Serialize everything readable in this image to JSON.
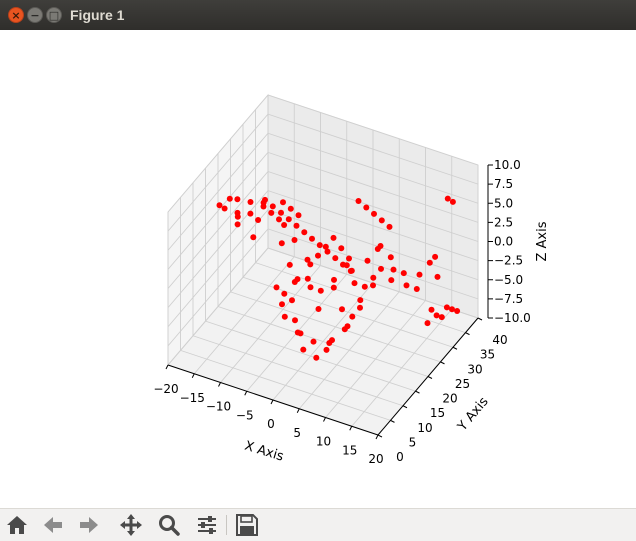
{
  "window": {
    "title": "Figure 1",
    "close_glyph": "×",
    "minimize_glyph": "−",
    "maximize_glyph": "□"
  },
  "toolbar": {
    "buttons": [
      {
        "name": "home-button",
        "icon": "home-icon"
      },
      {
        "name": "back-button",
        "icon": "arrow-left-icon"
      },
      {
        "name": "forward-button",
        "icon": "arrow-right-icon"
      },
      {
        "name": "pan-button",
        "icon": "move-icon"
      },
      {
        "name": "zoom-button",
        "icon": "magnifier-icon"
      },
      {
        "name": "configure-subplots-button",
        "icon": "sliders-icon"
      },
      {
        "name": "save-button",
        "icon": "floppy-disk-icon"
      }
    ]
  },
  "chart_data": {
    "type": "scatter",
    "projection": "3d",
    "title": "",
    "xlabel": "X Axis",
    "ylabel": "Y Axis",
    "zlabel": "Z Axis",
    "xlim": [
      -20,
      20
    ],
    "ylim": [
      0,
      40
    ],
    "zlim": [
      -10,
      10
    ],
    "xticks": [
      "−20",
      "−15",
      "−10",
      "−5",
      "0",
      "5",
      "10",
      "15",
      "20"
    ],
    "yticks": [
      "0",
      "5",
      "10",
      "15",
      "20",
      "25",
      "30",
      "35",
      "40"
    ],
    "zticks": [
      "−10.0",
      "−7.5",
      "−5.0",
      "−2.5",
      "0.0",
      "2.5",
      "5.0",
      "7.5",
      "10.0"
    ],
    "grid": true,
    "marker_color": "#ff0000",
    "series": [
      {
        "points": [
          [
            -14,
            8,
            9.2
          ],
          [
            -13.5,
            9,
            8.5
          ],
          [
            -13,
            10,
            9.5
          ],
          [
            -12,
            11,
            7.5
          ],
          [
            -12.5,
            12,
            8.8
          ],
          [
            -11,
            9,
            8
          ],
          [
            -11.5,
            10,
            6.5
          ],
          [
            -10,
            12,
            9
          ],
          [
            -10.5,
            13,
            7
          ],
          [
            -9,
            11,
            5
          ],
          [
            -9.5,
            14,
            6
          ],
          [
            -8,
            13,
            8.5
          ],
          [
            -7.5,
            12,
            9.5
          ],
          [
            -7,
            14,
            7.5
          ],
          [
            -6,
            15,
            6.5
          ],
          [
            -5.5,
            16,
            5.5
          ],
          [
            -5,
            14,
            4
          ],
          [
            -4,
            17,
            3.5
          ],
          [
            -3,
            13,
            2
          ],
          [
            -2,
            18,
            1
          ],
          [
            -1,
            16,
            -0.5
          ],
          [
            0,
            15,
            -1
          ],
          [
            1,
            17,
            -2
          ],
          [
            2,
            14,
            -3
          ],
          [
            3,
            18,
            -1.5
          ],
          [
            4,
            16,
            0.5
          ],
          [
            5,
            19,
            1.5
          ],
          [
            6,
            15,
            -2.5
          ],
          [
            7,
            17,
            -4
          ],
          [
            8,
            18,
            -3
          ],
          [
            9,
            16,
            -1
          ],
          [
            10,
            19,
            0
          ],
          [
            11,
            17,
            2
          ],
          [
            12,
            18,
            3
          ],
          [
            13,
            20,
            1
          ],
          [
            -4,
            12,
            -3
          ],
          [
            -3,
            11,
            -4
          ],
          [
            -2,
            13,
            -5
          ],
          [
            -1,
            12,
            -6
          ],
          [
            0,
            11,
            -5.5
          ],
          [
            1,
            10,
            -7
          ],
          [
            2,
            12,
            -6.5
          ],
          [
            3,
            11,
            -8
          ],
          [
            4,
            13,
            -7.5
          ],
          [
            5,
            12,
            -6
          ],
          [
            6,
            11,
            -5
          ],
          [
            7,
            14,
            -4.5
          ],
          [
            8,
            13,
            -3.5
          ],
          [
            -6,
            14,
            -2
          ],
          [
            -5,
            15,
            -3
          ],
          [
            -4,
            16,
            -4
          ],
          [
            -3,
            15,
            -1
          ],
          [
            -2,
            14,
            0
          ],
          [
            -1,
            17,
            1
          ],
          [
            0,
            18,
            2
          ],
          [
            1,
            19,
            3
          ],
          [
            2,
            20,
            4
          ],
          [
            3,
            21,
            2.5
          ],
          [
            4,
            22,
            1
          ],
          [
            5,
            21,
            0
          ],
          [
            6,
            20,
            -1
          ],
          [
            7,
            22,
            -2
          ],
          [
            8,
            21,
            2
          ],
          [
            9,
            23,
            3
          ],
          [
            10,
            22,
            4
          ],
          [
            11,
            24,
            2
          ],
          [
            12,
            23,
            1
          ],
          [
            13,
            25,
            0
          ],
          [
            14,
            24,
            -1
          ],
          [
            15,
            26,
            -2
          ],
          [
            16,
            25,
            0.5
          ],
          [
            17,
            27,
            1.5
          ],
          [
            18,
            28,
            -0.5
          ],
          [
            19,
            30,
            9.2
          ],
          [
            19.5,
            31,
            8.5
          ],
          [
            18.5,
            26,
            3
          ],
          [
            18,
            24,
            -5
          ],
          [
            -8,
            20,
            5
          ],
          [
            -7,
            21,
            4
          ],
          [
            -6,
            22,
            3
          ],
          [
            -5,
            23,
            2
          ],
          [
            -4,
            24,
            1
          ],
          [
            -3,
            25,
            0
          ],
          [
            -2,
            26,
            -1
          ],
          [
            -1,
            27,
            -2
          ],
          [
            0,
            28,
            -3
          ],
          [
            1,
            29,
            -4
          ],
          [
            2,
            30,
            5
          ],
          [
            3,
            31,
            4
          ],
          [
            4,
            32,
            3
          ],
          [
            5,
            33,
            2
          ],
          [
            6,
            34,
            1
          ],
          [
            -10,
            25,
            4
          ],
          [
            -9,
            26,
            3
          ],
          [
            -8,
            27,
            2
          ],
          [
            -12,
            22,
            5
          ],
          [
            -11,
            23,
            4
          ],
          [
            14,
            34,
            -8
          ],
          [
            14.5,
            35,
            -9
          ],
          [
            15,
            36,
            -9.5
          ],
          [
            15.5,
            37,
            -8.5
          ],
          [
            16,
            38,
            -9
          ],
          [
            16.5,
            39,
            -9.5
          ]
        ]
      }
    ]
  }
}
